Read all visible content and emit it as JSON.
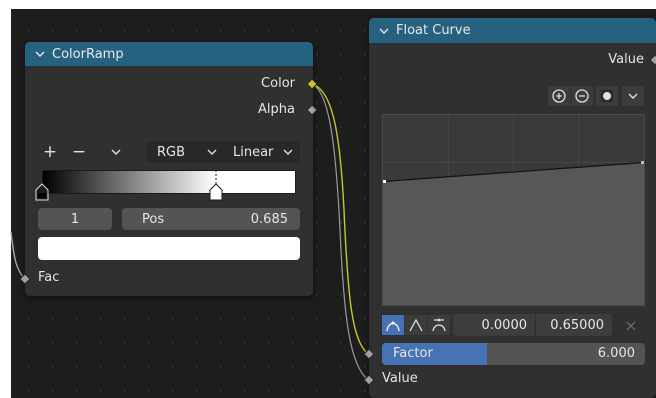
{
  "colorramp": {
    "title": "ColorRamp",
    "outputs": {
      "color": "Color",
      "alpha": "Alpha"
    },
    "toolbar": {
      "add": "+",
      "remove": "−",
      "color_mode": "RGB",
      "interpolation": "Linear"
    },
    "ramp": {
      "gradient_from": "#000000",
      "gradient_to": "#ffffff",
      "stops": [
        {
          "position": 0.0,
          "color": "#000000",
          "active": false
        },
        {
          "position": 0.685,
          "color": "#ffffff",
          "active": true
        }
      ]
    },
    "active_stop": {
      "index": "1",
      "pos_label": "Pos",
      "pos_value": "0.685"
    },
    "active_color": "#ffffff",
    "input": {
      "fac": "Fac"
    }
  },
  "floatcurve": {
    "title": "Float Curve",
    "output": "Value",
    "view_controls": [
      "zoom-in-icon",
      "zoom-out-icon",
      "clipping-icon",
      "chevron-down-icon"
    ],
    "curve": {
      "points": [
        [
          0.0,
          0.65
        ],
        [
          1.0,
          0.75
        ]
      ]
    },
    "handle_types": [
      "auto-handle-icon",
      "vector-handle-icon",
      "auto-clamped-handle-icon"
    ],
    "selected_point": {
      "x": "0.0000",
      "y": "0.65000",
      "delete": "×"
    },
    "factor": {
      "label": "Factor",
      "value": "6.000",
      "fill": 0.4
    },
    "input": "Value"
  },
  "colors": {
    "header": "#26627f",
    "node_bg": "#303030",
    "socket_color": "#c7c729",
    "socket_float": "#a1a1a1",
    "accent": "#4772b3"
  }
}
